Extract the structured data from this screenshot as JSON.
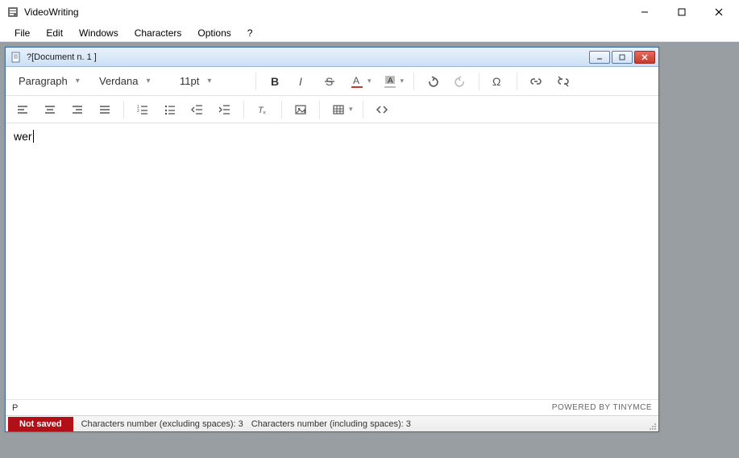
{
  "app": {
    "title": "VideoWriting"
  },
  "menu": {
    "items": [
      "File",
      "Edit",
      "Windows",
      "Characters",
      "Options",
      "?"
    ]
  },
  "doc": {
    "title": "?[Document n. 1 ]"
  },
  "toolbar": {
    "paragraph_label": "Paragraph",
    "font_label": "Verdana",
    "size_label": "11pt",
    "text_color": "#c0392b",
    "highlight_color": "#bdbdbd"
  },
  "editor": {
    "content": "wer",
    "path": "P"
  },
  "status": {
    "powered": "POWERED BY TINYMCE"
  },
  "footer": {
    "not_saved": "Not saved",
    "chars_ex_label": "Characters number (excluding spaces):",
    "chars_ex_value": "3",
    "chars_inc_label": "Characters number (including spaces):",
    "chars_inc_value": "3"
  }
}
